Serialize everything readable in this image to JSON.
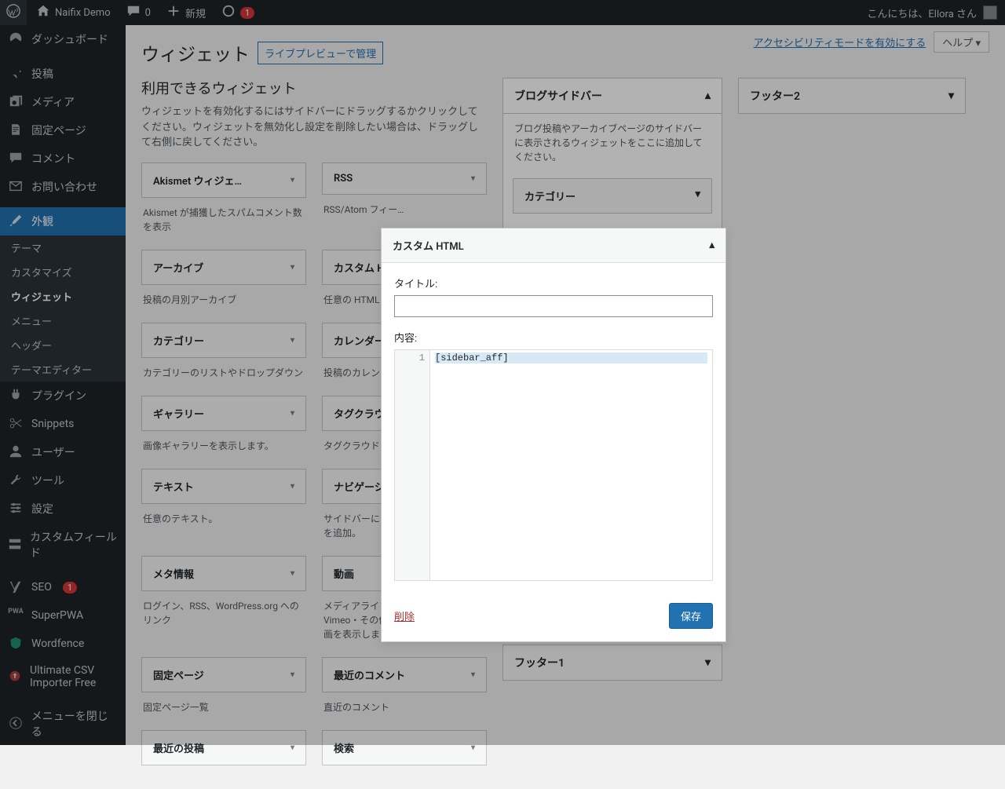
{
  "adminbar": {
    "site_name": "Naifix Demo",
    "comment_count": "0",
    "new_label": "新規",
    "notify_count": "1",
    "greeting": "こんにちは、Ellora さん"
  },
  "sidebar": {
    "items": [
      {
        "label": "ダッシュボード",
        "icon": "dashboard"
      },
      {
        "label": "投稿",
        "icon": "pin"
      },
      {
        "label": "メディア",
        "icon": "media"
      },
      {
        "label": "固定ページ",
        "icon": "page"
      },
      {
        "label": "コメント",
        "icon": "comment"
      },
      {
        "label": "お問い合わせ",
        "icon": "mail"
      },
      {
        "label": "外観",
        "icon": "brush",
        "current": true
      },
      {
        "label": "プラグイン",
        "icon": "plug"
      },
      {
        "label": "Snippets",
        "icon": "scissors"
      },
      {
        "label": "ユーザー",
        "icon": "user"
      },
      {
        "label": "ツール",
        "icon": "wrench"
      },
      {
        "label": "設定",
        "icon": "slider"
      },
      {
        "label": "カスタムフィールド",
        "icon": "fields"
      },
      {
        "label": "SEO",
        "icon": "seo",
        "badge": "1"
      },
      {
        "label": "SuperPWA",
        "icon": "pwa"
      },
      {
        "label": "Wordfence",
        "icon": "wf"
      },
      {
        "label": "Ultimate CSV Importer Free",
        "icon": "csv"
      },
      {
        "label": "メニューを閉じる",
        "icon": "collapse"
      }
    ],
    "submenu": [
      "テーマ",
      "カスタマイズ",
      "ウィジェット",
      "メニュー",
      "ヘッダー",
      "テーマエディター"
    ]
  },
  "topbar": {
    "a11y_link": "アクセシビリティモードを有効にする",
    "help": "ヘルプ ▾"
  },
  "page": {
    "title": "ウィジェット",
    "alt_link": "ライブプレビューで管理"
  },
  "available": {
    "heading": "利用できるウィジェット",
    "help": "ウィジェットを有効化するにはサイドバーにドラッグするかクリックしてください。ウィジェットを無効化し設定を削除したい場合は、ドラッグして右側に戻してください。",
    "widgets": [
      {
        "title": "Akismet ウィジェ…",
        "desc": "Akismet が捕獲したスパムコメント数を表示"
      },
      {
        "title": "RSS",
        "desc": "RSS/Atom フィー…"
      },
      {
        "title": "アーカイブ",
        "desc": "投稿の月別アーカイブ"
      },
      {
        "title": "カスタム HTML",
        "desc": "任意の HTML コ…"
      },
      {
        "title": "カテゴリー",
        "desc": "カテゴリーのリストやドロップダウン"
      },
      {
        "title": "カレンダー",
        "desc": "投稿のカレンダー"
      },
      {
        "title": "ギャラリー",
        "desc": "画像ギャラリーを表示します。"
      },
      {
        "title": "タグクラウド",
        "desc": "タグクラウド"
      },
      {
        "title": "テキスト",
        "desc": "任意のテキスト。"
      },
      {
        "title": "ナビゲーション…",
        "desc": "サイドバーにナビゲーションメニューを追加。"
      },
      {
        "title": "メタ情報",
        "desc": "ログイン、RSS、WordPress.org へのリンク"
      },
      {
        "title": "動画",
        "desc": "メディアライブラリまたは YouTube・Vimeo・その他のプロバイダからの動画を表示します。"
      },
      {
        "title": "固定ページ",
        "desc": "固定ページ一覧"
      },
      {
        "title": "最近のコメント",
        "desc": "直近のコメント"
      },
      {
        "title": "最近の投稿",
        "desc": ""
      },
      {
        "title": "検索",
        "desc": ""
      }
    ]
  },
  "areas": {
    "blog": {
      "title": "ブログサイドバー",
      "desc": "ブログ投稿やアーカイブページのサイドバーに表示されるウィジェットをここに追加してください。",
      "items": [
        "カテゴリー"
      ]
    },
    "footer1": {
      "title": "フッター1"
    },
    "footer2": {
      "title": "フッター2"
    }
  },
  "modal": {
    "title": "カスタム HTML",
    "title_label": "タイトル:",
    "title_value": "",
    "content_label": "内容:",
    "line_num": "1",
    "code": "[sidebar_aff]",
    "delete": "削除",
    "save": "保存"
  }
}
